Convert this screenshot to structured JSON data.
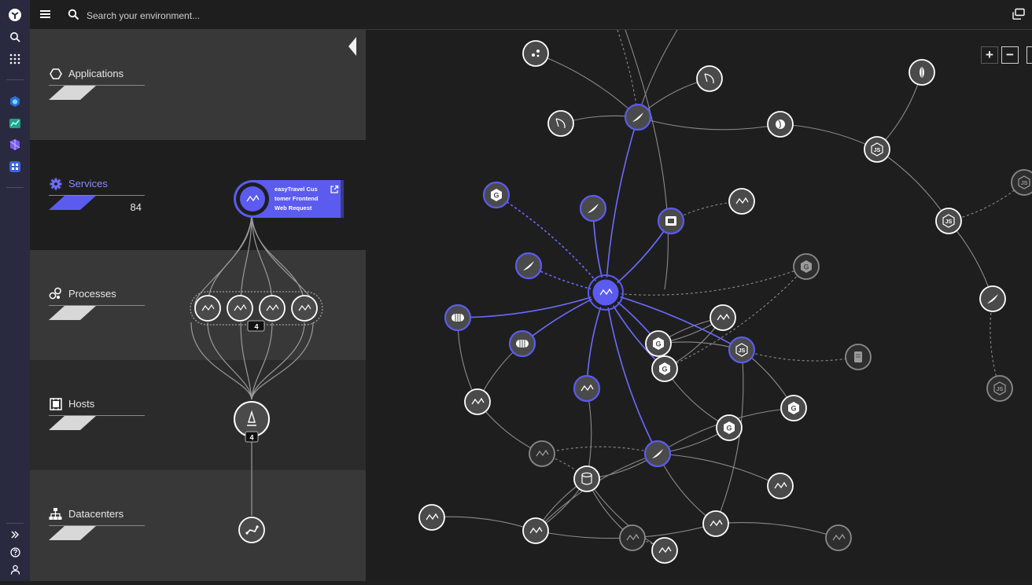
{
  "topbar": {
    "search_placeholder": "Search your environment..."
  },
  "rail": {
    "items": [
      "logo-icon",
      "search-icon",
      "apps-grid-icon",
      "smartscape-icon",
      "dashboard-icon",
      "hub-icon",
      "grid-icon",
      "expand-icon",
      "help-icon",
      "user-icon"
    ]
  },
  "layers": [
    {
      "title": "Applications",
      "count": "",
      "active": false
    },
    {
      "title": "Services",
      "count": "84",
      "active": true
    },
    {
      "title": "Processes",
      "count": "",
      "active": false
    },
    {
      "title": "Hosts",
      "count": "",
      "active": false
    },
    {
      "title": "Datacenters",
      "count": "",
      "active": false
    }
  ],
  "selected_service": {
    "label": "easyTravel Customer Frontend Web Request",
    "label_lines": [
      "easyTravel Cus",
      "tomer Frontend",
      "Web Request"
    ]
  },
  "process_group": {
    "badge": "4"
  },
  "host_group": {
    "badge": "4"
  },
  "zoom": {
    "in_label": "+",
    "out_label": "−"
  },
  "colors": {
    "accent": "#5b5bf0",
    "node_fill": "#4a4a4a",
    "edge": "#8a8a8a",
    "panel_dark": "#1e1e1e",
    "panel_light": "#383838",
    "rail": "#292a40"
  }
}
